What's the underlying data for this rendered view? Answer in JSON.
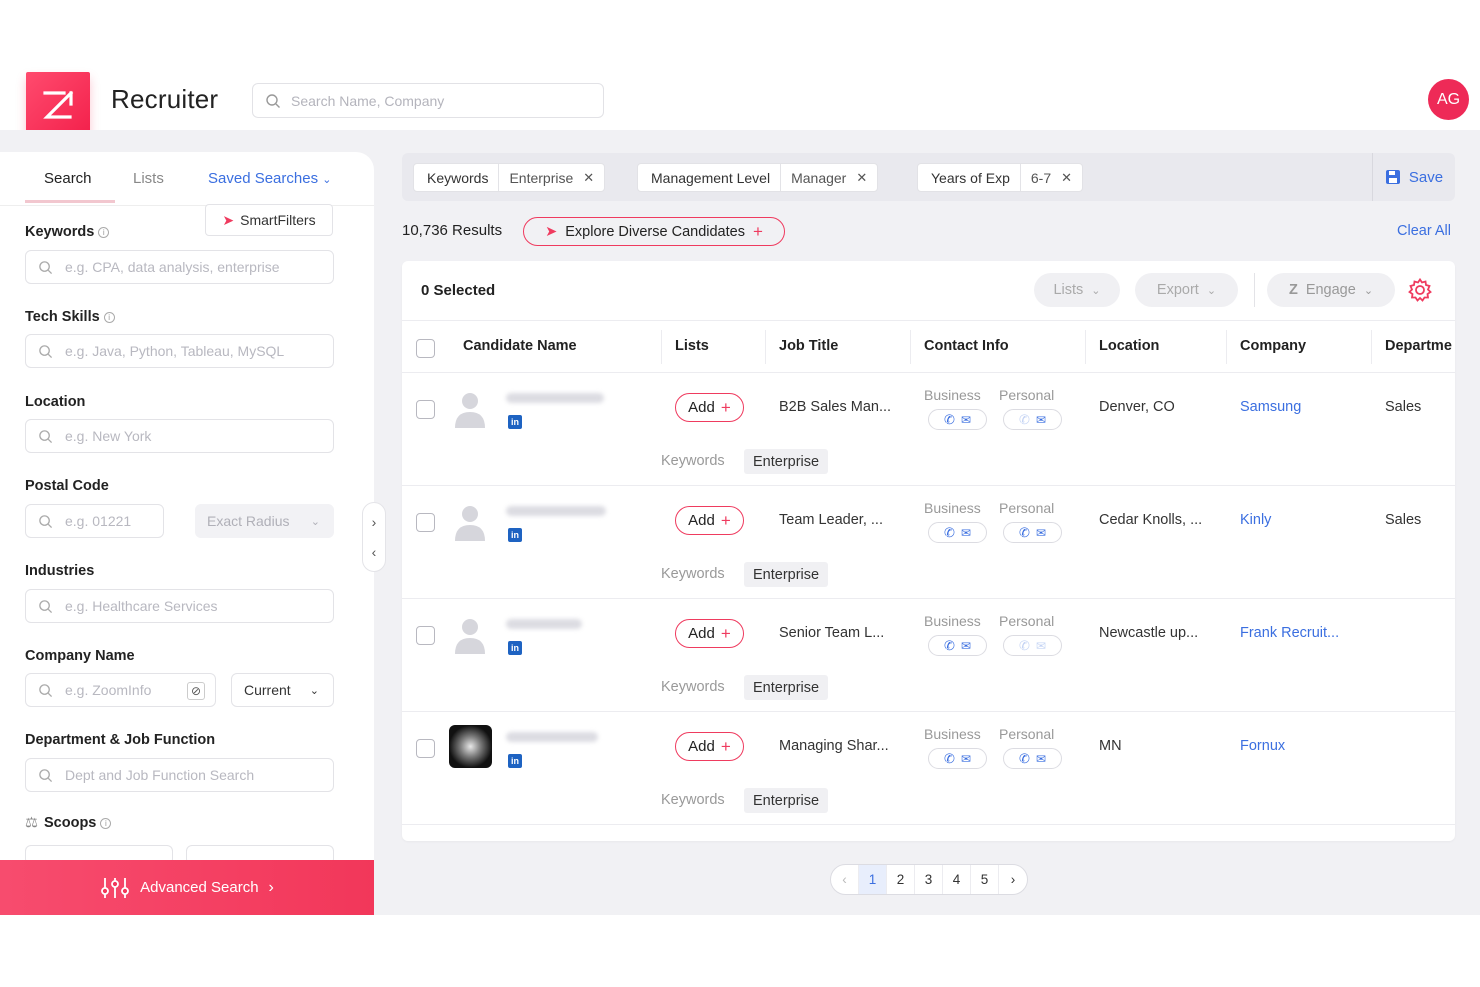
{
  "header": {
    "app_title": "Recruiter",
    "search_placeholder": "Search Name, Company",
    "avatar_initials": "AG"
  },
  "sidebar": {
    "tabs": {
      "search": "Search",
      "lists": "Lists",
      "saved": "Saved Searches"
    },
    "smartfilters_label": "SmartFilters",
    "fields": {
      "keywords": {
        "label": "Keywords",
        "placeholder": "e.g. CPA, data analysis, enterprise"
      },
      "tech_skills": {
        "label": "Tech Skills",
        "placeholder": "e.g. Java, Python, Tableau, MySQL"
      },
      "location": {
        "label": "Location",
        "placeholder": "e.g. New York"
      },
      "postal_code": {
        "label": "Postal Code",
        "placeholder": "e.g. 01221",
        "radius": "Exact Radius"
      },
      "industries": {
        "label": "Industries",
        "placeholder": "e.g. Healthcare Services"
      },
      "company_name": {
        "label": "Company Name",
        "placeholder": "e.g. ZoomInfo",
        "scope": "Current"
      },
      "department": {
        "label": "Department & Job Function",
        "placeholder": "Dept and Job Function Search"
      },
      "scoops": {
        "label": "Scoops"
      }
    },
    "advanced_search": "Advanced Search"
  },
  "filters": {
    "chips": [
      {
        "key": "Keywords",
        "value": "Enterprise"
      },
      {
        "key": "Management Level",
        "value": "Manager"
      },
      {
        "key": "Years of Exp",
        "value": "6-7"
      }
    ],
    "save_label": "Save"
  },
  "results": {
    "count_text": "10,736 Results",
    "diverse_label": "Explore Diverse Candidates",
    "clear_all": "Clear All"
  },
  "table": {
    "selected_text": "0 Selected",
    "toolbar": {
      "lists": "Lists",
      "export": "Export",
      "engage": "Engage"
    },
    "columns": [
      "Candidate Name",
      "Lists",
      "Job Title",
      "Contact Info",
      "Location",
      "Company",
      "Departme"
    ],
    "contact_labels": {
      "business": "Business",
      "personal": "Personal"
    },
    "add_label": "Add",
    "keywords_label": "Keywords",
    "rows": [
      {
        "job_title": "B2B Sales Man...",
        "location": "Denver, CO",
        "company": "Samsung",
        "department": "Sales",
        "keyword": "Enterprise"
      },
      {
        "job_title": "Team Leader, ...",
        "location": "Cedar Knolls, ...",
        "company": "Kinly",
        "department": "Sales",
        "keyword": "Enterprise"
      },
      {
        "job_title": "Senior Team L...",
        "location": "Newcastle up...",
        "company": "Frank Recruit...",
        "department": "",
        "keyword": "Enterprise"
      },
      {
        "job_title": "Managing Shar...",
        "location": "MN",
        "company": "Fornux",
        "department": "",
        "keyword": "Enterprise"
      }
    ]
  },
  "pagination": {
    "pages": [
      "1",
      "2",
      "3",
      "4",
      "5"
    ],
    "current": "1"
  },
  "colors": {
    "brand": "#f2375a",
    "link": "#3b6fe0"
  }
}
